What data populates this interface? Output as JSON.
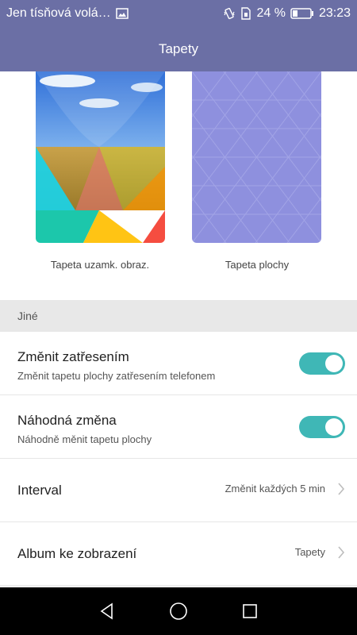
{
  "status_bar": {
    "notification_text": "Jen tísňová volá…",
    "battery_percent": "24 %",
    "time": "23:23",
    "icons": [
      "image-icon",
      "vibrate-icon",
      "sim-icon",
      "battery-icon"
    ]
  },
  "header": {
    "title": "Tapety"
  },
  "wallpapers": {
    "lock_label": "Tapeta uzamk. obraz.",
    "home_label": "Tapeta plochy"
  },
  "section": {
    "title": "Jiné"
  },
  "settings": {
    "shake": {
      "title": "Změnit zatřesením",
      "subtitle": "Změnit tapetu plochy zatřesením telefonem",
      "enabled": true
    },
    "random": {
      "title": "Náhodná změna",
      "subtitle": "Náhodně měnit tapetu plochy",
      "enabled": true
    },
    "interval": {
      "title": "Interval",
      "value": "Změnit každých 5 min"
    },
    "album": {
      "title": "Album ke zobrazení",
      "value": "Tapety"
    }
  },
  "colors": {
    "header_bg": "#6B6FA5",
    "toggle_on": "#3FB7B6",
    "home_wallpaper": "#8E90DE",
    "section_bg": "#E8E8E8"
  }
}
